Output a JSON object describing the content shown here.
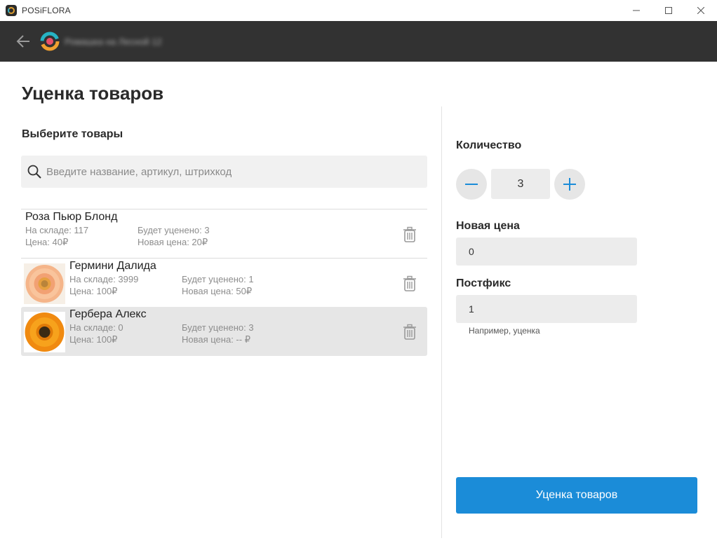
{
  "window": {
    "title": "POSiFLORA",
    "minimize_symbol": "—",
    "maximize_symbol": "☐",
    "close_symbol": "✕"
  },
  "appbar": {
    "back_icon": "arrow-left-icon",
    "logo_icon": "posiflora-logo-icon",
    "store_name": "Ромашка на Лесной 12"
  },
  "left": {
    "page_title": "Уценка товаров",
    "section_title": "Выберите товары",
    "search": {
      "placeholder": "Введите название, артикул, штрихкод",
      "value": ""
    },
    "items": [
      {
        "name": "Роза Пьюр Блонд",
        "stock": "На складе: 117",
        "price": "Цена: 40₽",
        "markdown": "Будет уценено: 3",
        "new_price": "Новая цена: 20₽",
        "has_image": false
      },
      {
        "name": "Гермини Далида",
        "stock": "На складе: 3999",
        "price": "Цена: 100₽",
        "markdown": "Будет уценено: 1",
        "new_price": "Новая цена: 50₽",
        "has_image": true,
        "image": "peach-gerbera"
      },
      {
        "name": "Гербера Алекс",
        "stock": "На складе: 0",
        "price": "Цена: 100₽",
        "markdown": "Будет уценено: 3",
        "new_price": "Новая цена: -- ₽",
        "has_image": true,
        "image": "orange-gerbera",
        "selected": true
      }
    ]
  },
  "right": {
    "quantity_label": "Количество",
    "quantity_value": "3",
    "new_price_label": "Новая цена",
    "new_price_value": "0",
    "postfix_label": "Постфикс",
    "postfix_value": "1",
    "postfix_hint": "Например, уценка",
    "submit_label": "Уценка товаров"
  },
  "colors": {
    "accent": "#1b8cd8",
    "appbar": "#323232",
    "selected_row": "#e6e6e6"
  }
}
